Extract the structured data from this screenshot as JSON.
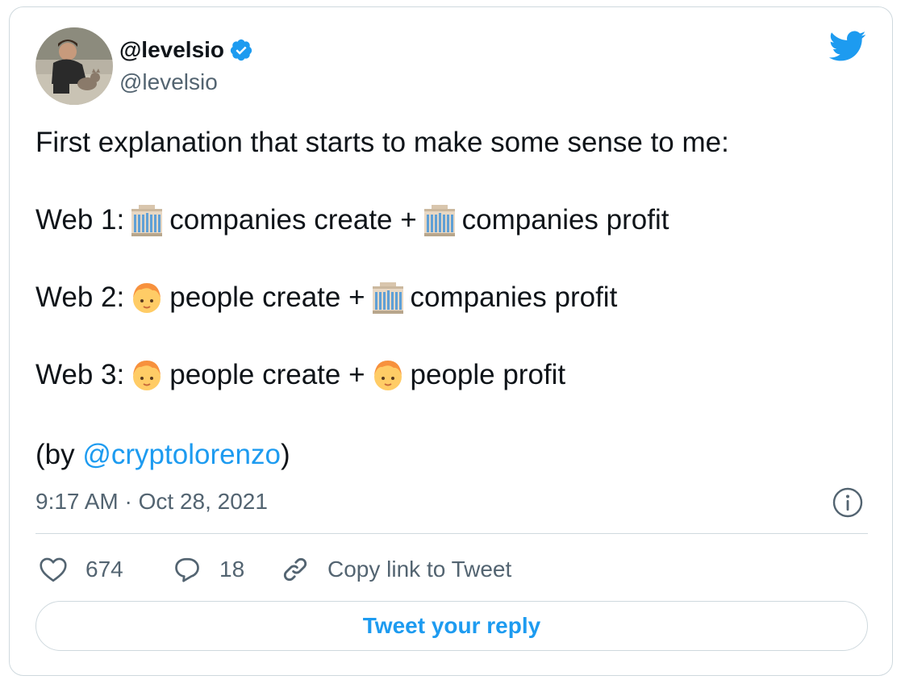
{
  "author": {
    "display_name": "@levelsio",
    "handle": "@levelsio",
    "verified": true,
    "avatar_icon": "profile-photo"
  },
  "brand": {
    "logo_icon": "twitter-bird-icon",
    "accent_color": "#1d9bf0"
  },
  "tweet": {
    "line1": "First explanation that starts to make some sense to me:",
    "web1": {
      "label": "Web 1:",
      "emoji1": "office-building-emoji",
      "part1": "companies create +",
      "emoji2": "office-building-emoji",
      "part2": "companies profit"
    },
    "web2": {
      "label": "Web 2:",
      "emoji1": "person-emoji",
      "part1": "people create +",
      "emoji2": "office-building-emoji",
      "part2": "companies profit"
    },
    "web3": {
      "label": "Web 3:",
      "emoji1": "person-emoji",
      "part1": "people create +",
      "emoji2": "person-emoji",
      "part2": "people profit"
    },
    "credit_open": "(by ",
    "credit_mention": "@cryptolorenzo",
    "credit_close": ")"
  },
  "timestamp": "9:17 AM · Oct 28, 2021",
  "actions": {
    "like_icon": "heart-icon",
    "like_count": "674",
    "reply_icon": "speech-bubble-icon",
    "reply_count": "18",
    "copy_icon": "link-icon",
    "copy_label": "Copy link to Tweet"
  },
  "reply_button": {
    "label": "Tweet your reply"
  },
  "info_icon": "info-icon"
}
